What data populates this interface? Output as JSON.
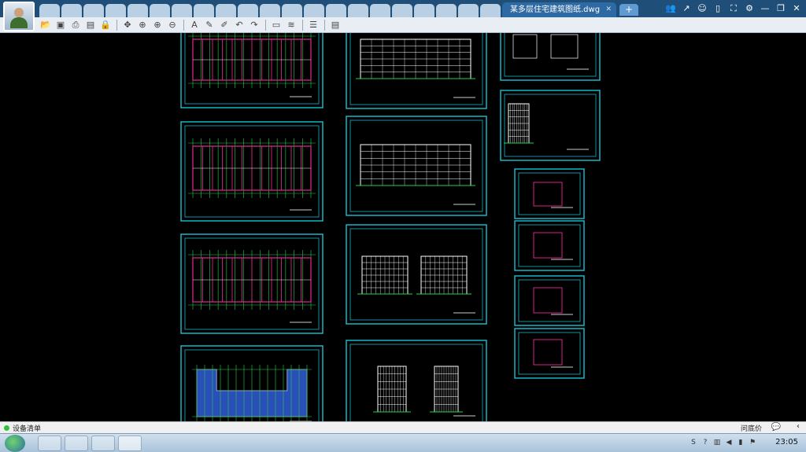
{
  "window": {
    "tab_title": "某多层住宅建筑图纸.dwg",
    "inactive_tab_count": 22,
    "new_tab_label": "+"
  },
  "toolbar": {
    "groups": [
      [
        "folder-open-icon",
        "save-icon",
        "print-icon",
        "pdf-export-icon",
        "lock-icon"
      ],
      [
        "pan-icon",
        "zoom-window-icon",
        "zoom-in-icon",
        "zoom-out-icon"
      ],
      [
        "text-icon",
        "pencil-icon",
        "highlighter-icon",
        "undo-icon",
        "redo-icon"
      ],
      [
        "measure-icon",
        "dimension-icon"
      ],
      [
        "layers-icon"
      ],
      [
        "document-properties-icon"
      ]
    ]
  },
  "window_controls": [
    "users-icon",
    "share-icon",
    "chat-icon",
    "mobile-icon",
    "fullscreen-icon",
    "settings-icon",
    "minimize-icon",
    "restore-icon",
    "close-icon"
  ],
  "statusbar": {
    "status_text": "设备清单",
    "price_ask_label": "问底价",
    "chat_label": "💬",
    "collapse_label": "‹"
  },
  "taskbar": {
    "clock": "23:05",
    "tray_icons": [
      "sogou-input-icon",
      "help-icon",
      "network-icon",
      "volume-icon",
      "battery-icon",
      "action-center-icon"
    ]
  },
  "colors": {
    "sheet_border": "#18b6c7",
    "plan_wall": "#d6248a",
    "plan_grid": "#22d24a",
    "elevation_lines": "#ffffff",
    "roof_fill": "#2a4fb8",
    "tab_bar": "#1f4e78"
  }
}
